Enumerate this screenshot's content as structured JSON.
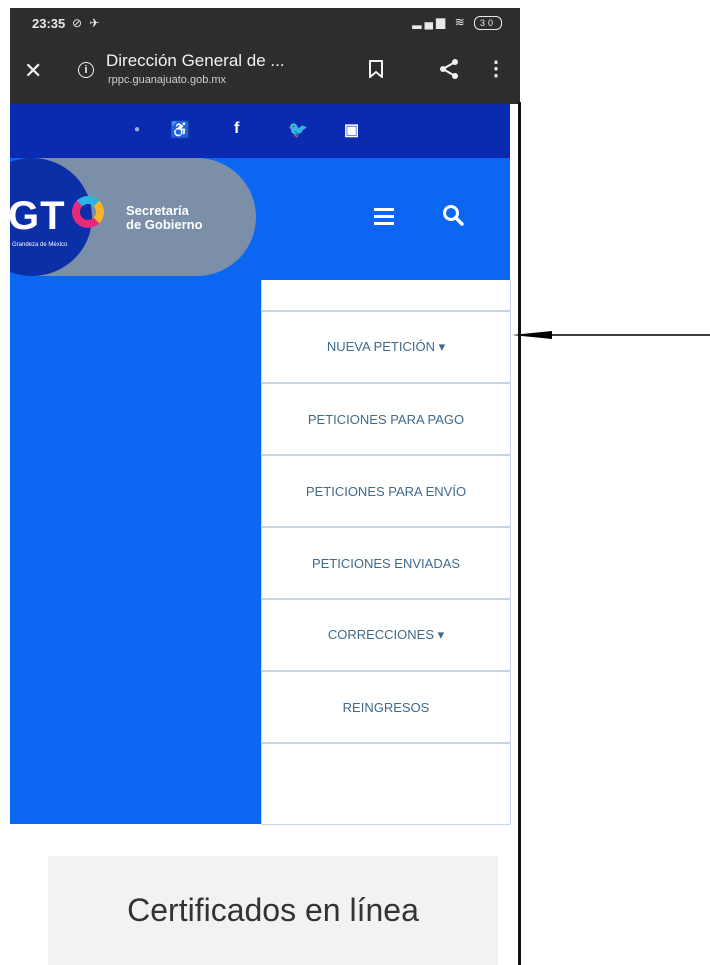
{
  "status_bar": {
    "time": "23:35",
    "battery": "30"
  },
  "browser": {
    "page_title": "Dirección General de ...",
    "url": "rppc.guanajuato.gob.mx",
    "close_symbol": "✕",
    "info_symbol": "i",
    "menu_symbol": "⋮"
  },
  "social": {
    "facebook": "f"
  },
  "header": {
    "logo_text": "GT",
    "logo_tagline": "Grandeza de México",
    "secretaria_line1": "Secretaría",
    "secretaria_line2": "de Gobierno"
  },
  "menu": {
    "items": [
      "NUEVA PETICIÓN ▾",
      "PETICIONES PARA PAGO",
      "PETICIONES PARA ENVÍO",
      "PETICIONES ENVIADAS",
      "CORRECCIONES ▾",
      "REINGRESOS"
    ]
  },
  "content": {
    "card_title": "Certificados en línea"
  },
  "colors": {
    "browser_chrome": "#2d2d2d",
    "social_bar": "#0a2bb0",
    "header_blue": "#0b66f2",
    "menu_text": "#3f6a8c"
  }
}
